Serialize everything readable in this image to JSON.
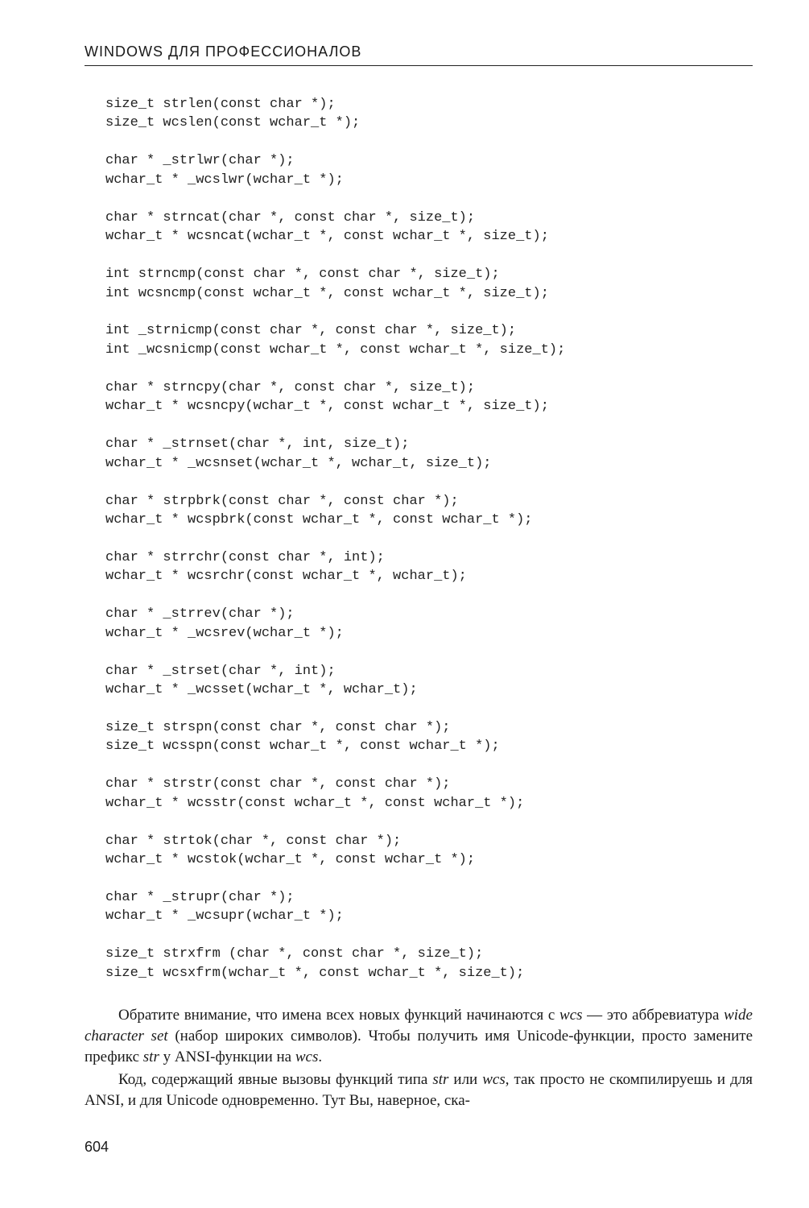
{
  "header": "WINDOWS ДЛЯ ПРОФЕССИОНАЛОВ",
  "code": "size_t strlen(const char *);\nsize_t wcslen(const wchar_t *);\n\nchar * _strlwr(char *);\nwchar_t * _wcslwr(wchar_t *);\n\nchar * strncat(char *, const char *, size_t);\nwchar_t * wcsncat(wchar_t *, const wchar_t *, size_t);\n\nint strncmp(const char *, const char *, size_t);\nint wcsncmp(const wchar_t *, const wchar_t *, size_t);\n\nint _strnicmp(const char *, const char *, size_t);\nint _wcsnicmp(const wchar_t *, const wchar_t *, size_t);\n\nchar * strncpy(char *, const char *, size_t);\nwchar_t * wcsncpy(wchar_t *, const wchar_t *, size_t);\n\nchar * _strnset(char *, int, size_t);\nwchar_t * _wcsnset(wchar_t *, wchar_t, size_t);\n\nchar * strpbrk(const char *, const char *);\nwchar_t * wcspbrk(const wchar_t *, const wchar_t *);\n\nchar * strrchr(const char *, int);\nwchar_t * wcsrchr(const wchar_t *, wchar_t);\n\nchar * _strrev(char *);\nwchar_t * _wcsrev(wchar_t *);\n\nchar * _strset(char *, int);\nwchar_t * _wcsset(wchar_t *, wchar_t);\n\nsize_t strspn(const char *, const char *);\nsize_t wcsspn(const wchar_t *, const wchar_t *);\n\nchar * strstr(const char *, const char *);\nwchar_t * wcsstr(const wchar_t *, const wchar_t *);\n\nchar * strtok(char *, const char *);\nwchar_t * wcstok(wchar_t *, const wchar_t *);\n\nchar * _strupr(char *);\nwchar_t * _wcsupr(wchar_t *);\n\nsize_t strxfrm (char *, const char *, size_t);\nsize_t wcsxfrm(wchar_t *, const wchar_t *, size_t);",
  "body": {
    "p1_a": "Обратите внимание, что имена всех новых функций начинаются с ",
    "p1_wcs": "wcs",
    "p1_b": " — это аббревиатура ",
    "p1_wcsfull": "wide character set",
    "p1_c": " (набор широких символов). Чтобы получить имя Unicode-функции, просто замените префикс ",
    "p1_str": "str",
    "p1_d": " у ANSI-функции на ",
    "p1_wcs2": "wcs",
    "p1_e": ".",
    "p2_a": "Код, содержащий явные вызовы функций типа ",
    "p2_str": "str",
    "p2_b": " или ",
    "p2_wcs": "wcs",
    "p2_c": ", так просто не скомпилируешь и для ANSI, и для Unicode одновременно. Тут Вы, наверное, ска-"
  },
  "pageNumber": "604"
}
